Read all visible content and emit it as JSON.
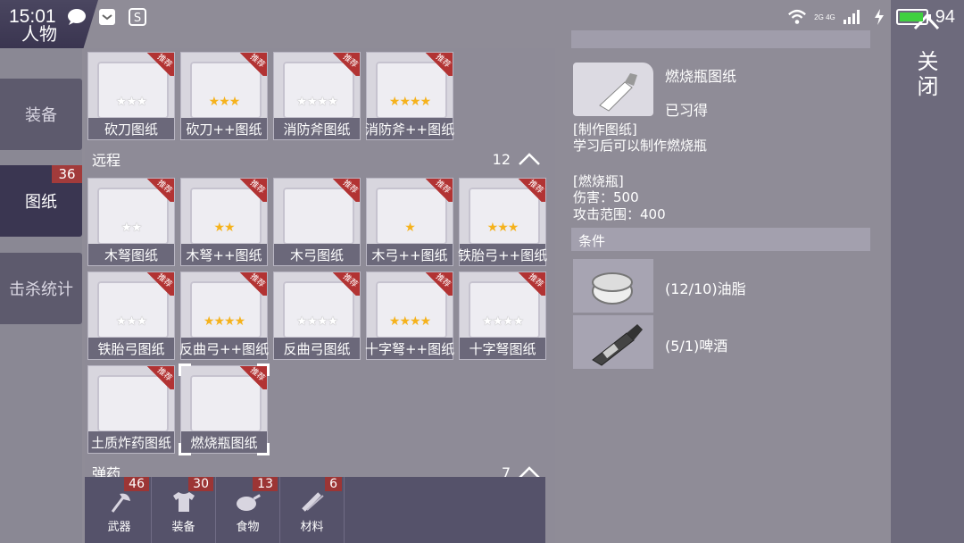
{
  "status_bar": {
    "time": "15:01",
    "network": "2G 4G",
    "battery": "94",
    "icons": [
      "chat-icon",
      "inbox-icon",
      "s-icon",
      "wifi-icon",
      "charging-icon"
    ]
  },
  "nav": {
    "title": "人物",
    "items": [
      {
        "label": "装备",
        "badge": ""
      },
      {
        "label": "图纸",
        "badge": "36"
      },
      {
        "label": "击杀统计",
        "badge": ""
      }
    ]
  },
  "melee_row": [
    {
      "label": "砍刀图纸",
      "stars_on": 0,
      "stars_total": 3,
      "tag": "推荐"
    },
    {
      "label": "砍刀++图纸",
      "stars_on": 3,
      "stars_total": 3,
      "tag": "推荐"
    },
    {
      "label": "消防斧图纸",
      "stars_on": 0,
      "stars_total": 4,
      "tag": "推荐"
    },
    {
      "label": "消防斧++图纸",
      "stars_on": 4,
      "stars_total": 4,
      "tag": "推荐"
    }
  ],
  "ranged_section": {
    "title": "远程",
    "count": "12"
  },
  "ranged_rows": [
    [
      {
        "label": "木弩图纸",
        "stars_on": 0,
        "stars_total": 2,
        "tag": "推荐"
      },
      {
        "label": "木弩++图纸",
        "stars_on": 2,
        "stars_total": 2,
        "tag": "推荐"
      },
      {
        "label": "木弓图纸",
        "stars_on": 0,
        "stars_total": 0,
        "tag": "推荐"
      },
      {
        "label": "木弓++图纸",
        "stars_on": 1,
        "stars_total": 1,
        "tag": "推荐"
      },
      {
        "label": "铁胎弓++图纸",
        "stars_on": 3,
        "stars_total": 3,
        "tag": "推荐"
      }
    ],
    [
      {
        "label": "铁胎弓图纸",
        "stars_on": 0,
        "stars_total": 3,
        "tag": "推荐"
      },
      {
        "label": "反曲弓++图纸",
        "stars_on": 4,
        "stars_total": 4,
        "tag": "推荐"
      },
      {
        "label": "反曲弓图纸",
        "stars_on": 0,
        "stars_total": 4,
        "tag": "推荐"
      },
      {
        "label": "十字弩++图纸",
        "stars_on": 4,
        "stars_total": 4,
        "tag": "推荐"
      },
      {
        "label": "十字弩图纸",
        "stars_on": 0,
        "stars_total": 4,
        "tag": "推荐"
      }
    ],
    [
      {
        "label": "土质炸药图纸",
        "stars_on": 0,
        "stars_total": 0,
        "tag": "推荐"
      },
      {
        "label": "燃烧瓶图纸",
        "stars_on": 0,
        "stars_total": 0,
        "tag": "推荐",
        "selected": true
      }
    ]
  ],
  "next_section": {
    "title": "弹药",
    "count": "7"
  },
  "bottom_tabs": [
    {
      "label": "武器",
      "badge": "46",
      "icon": "axe-icon"
    },
    {
      "label": "装备",
      "badge": "30",
      "icon": "shirt-icon"
    },
    {
      "label": "食物",
      "badge": "13",
      "icon": "meat-icon"
    },
    {
      "label": "材料",
      "badge": "6",
      "icon": "material-icon"
    }
  ],
  "detail": {
    "name": "燃烧瓶图纸",
    "status": "已习得",
    "blueprint_title": "[制作图纸]",
    "blueprint_desc": "学习后可以制作燃烧瓶",
    "item_title": "[燃烧瓶]",
    "damage": "伤害：500",
    "range": "攻击范围：400",
    "conditions_label": "条件",
    "conditions": [
      {
        "text": "(12/10)油脂",
        "icon": "grease-icon"
      },
      {
        "text": "(5/1)啤酒",
        "icon": "beer-bottle-icon"
      }
    ]
  },
  "close": {
    "label": "关闭"
  }
}
